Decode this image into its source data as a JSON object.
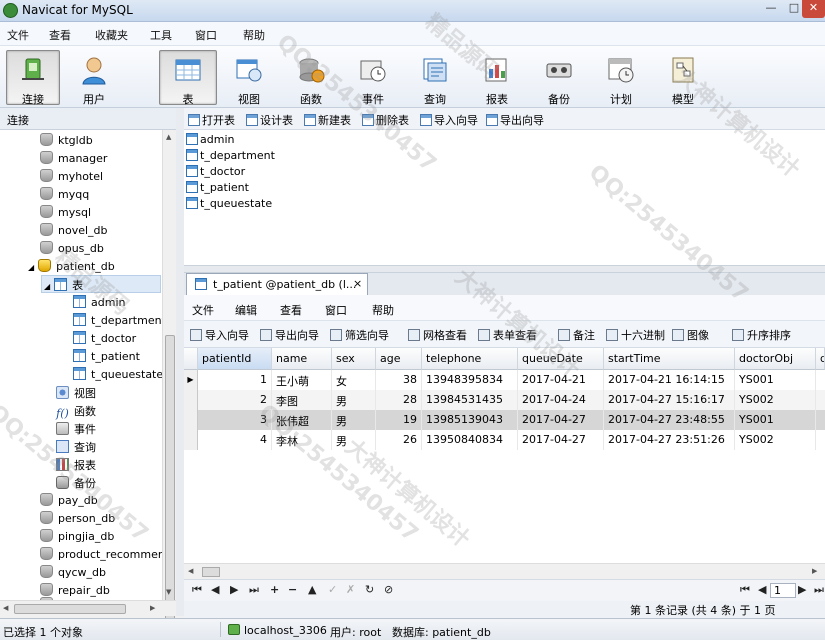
{
  "window": {
    "title": "Navicat for MySQL"
  },
  "menu": [
    "文件",
    "查看",
    "收藏夹",
    "工具",
    "窗口",
    "帮助"
  ],
  "toolbar": [
    {
      "label": "连接",
      "icon": "connection-icon"
    },
    {
      "label": "用户",
      "icon": "user-icon"
    },
    {
      "label": "表",
      "icon": "table-icon"
    },
    {
      "label": "视图",
      "icon": "view-icon"
    },
    {
      "label": "函数",
      "icon": "function-icon"
    },
    {
      "label": "事件",
      "icon": "event-icon"
    },
    {
      "label": "查询",
      "icon": "query-icon"
    },
    {
      "label": "报表",
      "icon": "report-icon"
    },
    {
      "label": "备份",
      "icon": "backup-icon"
    },
    {
      "label": "计划",
      "icon": "schedule-icon"
    },
    {
      "label": "模型",
      "icon": "model-icon"
    }
  ],
  "left_header": "连接",
  "tree": {
    "databases_above": [
      "ktgldb",
      "manager",
      "myhotel",
      "myqq",
      "mysql",
      "novel_db",
      "opus_db"
    ],
    "open_db": "patient_db",
    "tables_node": "表",
    "tables": [
      "admin",
      "t_department",
      "t_doctor",
      "t_patient",
      "t_queuestate"
    ],
    "sub_nodes": [
      "视图",
      "函数",
      "事件",
      "查询",
      "报表",
      "备份"
    ],
    "databases_below": [
      "pay_db",
      "person_db",
      "pingjia_db",
      "product_recommend",
      "qycw_db",
      "repair_db",
      "ss_db"
    ]
  },
  "object_toolbar": [
    "打开表",
    "设计表",
    "新建表",
    "删除表",
    "导入向导",
    "导出向导"
  ],
  "object_list": [
    "admin",
    "t_department",
    "t_doctor",
    "t_patient",
    "t_queuestate"
  ],
  "table_window": {
    "tab_title": "t_patient @patient_db (l...",
    "close_glyph": "×",
    "menu": [
      "文件",
      "编辑",
      "查看",
      "窗口",
      "帮助"
    ],
    "toolbar": [
      "导入向导",
      "导出向导",
      "筛选向导",
      "网格查看",
      "表单查看",
      "备注",
      "十六进制",
      "图像",
      "升序排序"
    ],
    "columns": [
      "patientId",
      "name",
      "sex",
      "age",
      "telephone",
      "queueDate",
      "startTime",
      "doctorObj",
      "q"
    ],
    "rows": [
      [
        "1",
        "王小萌",
        "女",
        "38",
        "13948395834",
        "2017-04-21",
        "2017-04-21 16:14:15",
        "YS001"
      ],
      [
        "2",
        "李图",
        "男",
        "28",
        "13984531435",
        "2017-04-24",
        "2017-04-27 15:16:17",
        "YS002"
      ],
      [
        "3",
        "张伟超",
        "男",
        "19",
        "13985139043",
        "2017-04-27",
        "2017-04-27 23:48:55",
        "YS001"
      ],
      [
        "4",
        "李林",
        "男",
        "26",
        "13950840834",
        "2017-04-27",
        "2017-04-27 23:51:26",
        "YS002"
      ]
    ],
    "current_row_marker": "▶",
    "nav_buttons": [
      "⏮",
      "◀",
      "▶",
      "⏭",
      "+",
      "−",
      "▲",
      "✓",
      "✗",
      "↻",
      "⊘"
    ],
    "page_number": "1",
    "record_info": "第 1 条记录 (共 4 条) 于 1 页"
  },
  "status": {
    "selected": "已选择 1 个对象",
    "connection": "localhost_3306",
    "user": "用户: root",
    "database": "数据库: patient_db"
  },
  "watermarks": [
    "QQ:2545340457",
    "大神计算机设计",
    "精品源码"
  ],
  "colors": {
    "selection": "#dde9f6",
    "active_tool": "#dcdcdc",
    "highlight_row": "#d6d6d6"
  }
}
